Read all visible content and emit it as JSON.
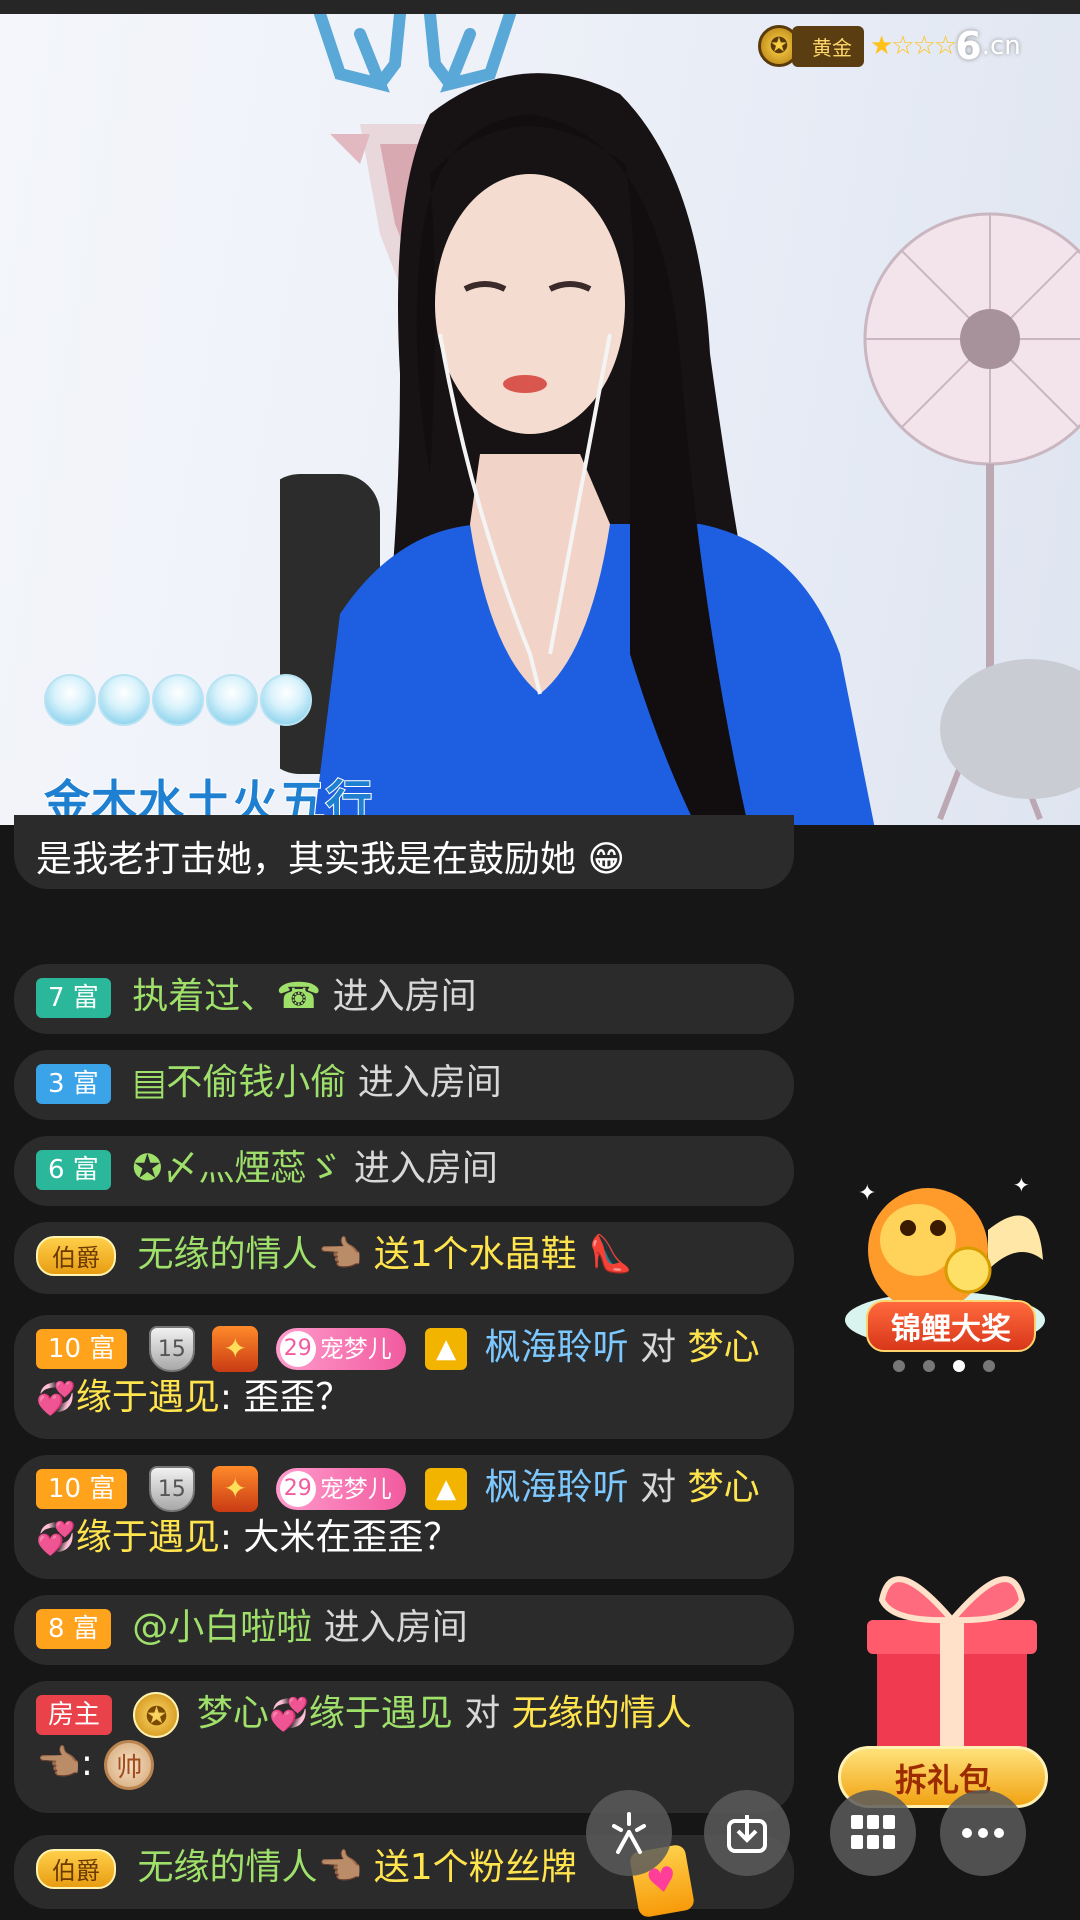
{
  "stream": {
    "rank_label": "黄金",
    "stars": "★☆☆☆",
    "site_logo": "6",
    "site_logo_suffix": ".cn",
    "overlay_title": "金木水土火五行"
  },
  "messages": [
    {
      "text": "是我老打击她，其实我是在鼓励她",
      "emoji": "😁"
    },
    {
      "badge": "7 富",
      "user": "执着过、☎",
      "action": "进入房间"
    },
    {
      "badge": "3 富",
      "user": "▤不偷钱小偷",
      "action": "进入房间"
    },
    {
      "badge": "6 富",
      "user": "✪〆灬煙蕊ゞ",
      "action": "进入房间"
    },
    {
      "badge": "伯爵",
      "user": "无缘的情人👈🏽",
      "action": "送1个水晶鞋",
      "gift": "👠"
    },
    {
      "badge": "10 富",
      "shield_level": "15",
      "fan_level": "29",
      "fan_name": "宠梦儿",
      "user": "枫海聆听",
      "to": "对",
      "target": "梦心",
      "hearts": "💞",
      "target2": "缘于遇见",
      "text": ": 歪歪？"
    },
    {
      "badge": "10 富",
      "shield_level": "15",
      "fan_level": "29",
      "fan_name": "宠梦儿",
      "user": "枫海聆听",
      "to": "对",
      "target": "梦心",
      "hearts": "💞",
      "target2": "缘于遇见",
      "text": ": 大米在歪歪？"
    },
    {
      "badge": "8 富",
      "user": "@小白啦啦",
      "action": "进入房间"
    },
    {
      "badge": "房主",
      "user": "梦心",
      "hearts": "💞",
      "user2": "缘于遇见",
      "to": "对",
      "target": "无缘的情人",
      "line2": "👈🏽:",
      "chess": "帅"
    },
    {
      "badge": "伯爵",
      "user": "无缘的情人👈🏽",
      "action": "送1个粉丝牌"
    }
  ],
  "widgets": {
    "koi_label": "锦鲤大奖",
    "gift_pack_label": "拆礼包"
  },
  "toolbar": {
    "share_icon": "六",
    "download_icon": "⬇",
    "grid_icon": "▦",
    "more_icon": "•••"
  },
  "colors": {
    "chat_bg": "#161616",
    "bubble_bg": "#2b2b2b",
    "username": "#9fe06b",
    "gift_text": "#ffe44d",
    "accent_blue": "#7cc8ff"
  }
}
